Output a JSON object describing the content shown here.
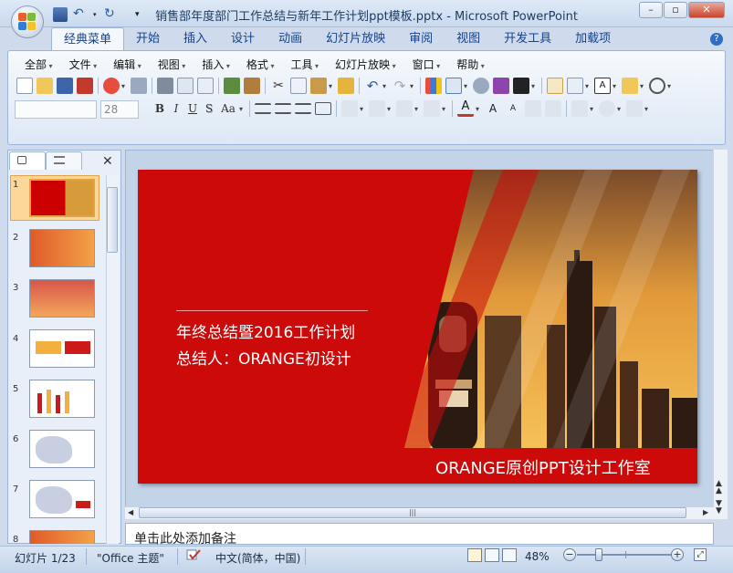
{
  "window": {
    "title": "销售部年度部门工作总结与新年工作计划ppt模板.pptx - Microsoft PowerPoint",
    "minimize": "–",
    "maximize": "▫",
    "close": "✕"
  },
  "ribbon": {
    "tabs": [
      "经典菜单",
      "开始",
      "插入",
      "设计",
      "动画",
      "幻灯片放映",
      "审阅",
      "视图",
      "开发工具",
      "加载项"
    ],
    "active_tab": "经典菜单",
    "menus": [
      "全部",
      "文件",
      "编辑",
      "视图",
      "插入",
      "格式",
      "工具",
      "幻灯片放映",
      "窗口",
      "帮助"
    ],
    "font_name": "",
    "font_size": "28",
    "format_buttons": [
      "B",
      "I",
      "U",
      "S",
      "Aa"
    ],
    "help": "?"
  },
  "slides_panel": {
    "numbers": [
      "1",
      "2",
      "3",
      "4",
      "5",
      "6",
      "7",
      "8"
    ],
    "close": "✕"
  },
  "slide": {
    "title": "年终总结暨2016工作计划",
    "author": "总结人：ORANGE初设计",
    "studio": "ORANGE原创PPT设计工作室"
  },
  "notes": {
    "placeholder": "单击此处添加备注"
  },
  "status": {
    "slide_counter": "幻灯片 1/23",
    "theme": "\"Office 主题\"",
    "language": "中文(简体，中国)",
    "zoom": "48%"
  }
}
